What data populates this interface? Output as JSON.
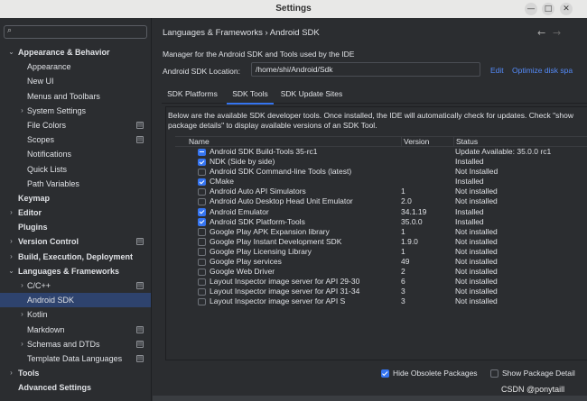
{
  "window": {
    "title": "Settings"
  },
  "search": {
    "placeholder": ""
  },
  "sidebar": {
    "items": [
      {
        "label": "Appearance & Behavior",
        "level": 0,
        "arrow": "expanded",
        "bold": true,
        "settings_icon": false,
        "selected": false
      },
      {
        "label": "Appearance",
        "level": 1,
        "arrow": "none",
        "bold": false,
        "settings_icon": false,
        "selected": false
      },
      {
        "label": "New UI",
        "level": 1,
        "arrow": "none",
        "bold": false,
        "settings_icon": false,
        "selected": false
      },
      {
        "label": "Menus and Toolbars",
        "level": 1,
        "arrow": "none",
        "bold": false,
        "settings_icon": false,
        "selected": false
      },
      {
        "label": "System Settings",
        "level": 1,
        "arrow": "collapsed",
        "bold": false,
        "settings_icon": false,
        "selected": false
      },
      {
        "label": "File Colors",
        "level": 1,
        "arrow": "none",
        "bold": false,
        "settings_icon": true,
        "selected": false
      },
      {
        "label": "Scopes",
        "level": 1,
        "arrow": "none",
        "bold": false,
        "settings_icon": true,
        "selected": false
      },
      {
        "label": "Notifications",
        "level": 1,
        "arrow": "none",
        "bold": false,
        "settings_icon": false,
        "selected": false
      },
      {
        "label": "Quick Lists",
        "level": 1,
        "arrow": "none",
        "bold": false,
        "settings_icon": false,
        "selected": false
      },
      {
        "label": "Path Variables",
        "level": 1,
        "arrow": "none",
        "bold": false,
        "settings_icon": false,
        "selected": false
      },
      {
        "label": "Keymap",
        "level": 0,
        "arrow": "none",
        "bold": true,
        "settings_icon": false,
        "selected": false
      },
      {
        "label": "Editor",
        "level": 0,
        "arrow": "collapsed",
        "bold": true,
        "settings_icon": false,
        "selected": false
      },
      {
        "label": "Plugins",
        "level": 0,
        "arrow": "none",
        "bold": true,
        "settings_icon": false,
        "selected": false
      },
      {
        "label": "Version Control",
        "level": 0,
        "arrow": "collapsed",
        "bold": true,
        "settings_icon": true,
        "selected": false
      },
      {
        "label": "Build, Execution, Deployment",
        "level": 0,
        "arrow": "collapsed",
        "bold": true,
        "settings_icon": false,
        "selected": false
      },
      {
        "label": "Languages & Frameworks",
        "level": 0,
        "arrow": "expanded",
        "bold": true,
        "settings_icon": false,
        "selected": false
      },
      {
        "label": "C/C++",
        "level": 1,
        "arrow": "collapsed",
        "bold": false,
        "settings_icon": true,
        "selected": false
      },
      {
        "label": "Android SDK",
        "level": 1,
        "arrow": "none",
        "bold": false,
        "settings_icon": false,
        "selected": true
      },
      {
        "label": "Kotlin",
        "level": 1,
        "arrow": "collapsed",
        "bold": false,
        "settings_icon": false,
        "selected": false
      },
      {
        "label": "Markdown",
        "level": 1,
        "arrow": "none",
        "bold": false,
        "settings_icon": true,
        "selected": false
      },
      {
        "label": "Schemas and DTDs",
        "level": 1,
        "arrow": "collapsed",
        "bold": false,
        "settings_icon": true,
        "selected": false
      },
      {
        "label": "Template Data Languages",
        "level": 1,
        "arrow": "none",
        "bold": false,
        "settings_icon": true,
        "selected": false
      },
      {
        "label": "Tools",
        "level": 0,
        "arrow": "collapsed",
        "bold": true,
        "settings_icon": false,
        "selected": false
      },
      {
        "label": "Advanced Settings",
        "level": 0,
        "arrow": "none",
        "bold": true,
        "settings_icon": false,
        "selected": false
      }
    ]
  },
  "main": {
    "breadcrumb": "Languages & Frameworks  ›  Android SDK",
    "description": "Manager for the Android SDK and Tools used by the IDE",
    "location_label": "Android SDK Location:",
    "location_value": "/home/shi/Android/Sdk",
    "edit_link": "Edit",
    "optimize_link": "Optimize disk spa",
    "tabs": [
      {
        "label": "SDK Platforms",
        "active": false
      },
      {
        "label": "SDK Tools",
        "active": true
      },
      {
        "label": "SDK Update Sites",
        "active": false
      }
    ],
    "notice": "Below are the available SDK developer tools. Once installed, the IDE will automatically check for updates. Check \"show package details\" to display available versions of an SDK Tool.",
    "columns": {
      "name": "Name",
      "version": "Version",
      "status": "Status"
    },
    "rows": [
      {
        "name": "Android SDK Build-Tools 35-rc1",
        "version": "",
        "status": "Update Available: 35.0.0 rc1",
        "check": "partial"
      },
      {
        "name": "NDK (Side by side)",
        "version": "",
        "status": "Installed",
        "check": "checked"
      },
      {
        "name": "Android SDK Command-line Tools (latest)",
        "version": "",
        "status": "Not Installed",
        "check": "unchecked"
      },
      {
        "name": "CMake",
        "version": "",
        "status": "Installed",
        "check": "checked"
      },
      {
        "name": "Android Auto API Simulators",
        "version": "1",
        "status": "Not installed",
        "check": "unchecked"
      },
      {
        "name": "Android Auto Desktop Head Unit Emulator",
        "version": "2.0",
        "status": "Not installed",
        "check": "unchecked"
      },
      {
        "name": "Android Emulator",
        "version": "34.1.19",
        "status": "Installed",
        "check": "checked"
      },
      {
        "name": "Android SDK Platform-Tools",
        "version": "35.0.0",
        "status": "Installed",
        "check": "checked"
      },
      {
        "name": "Google Play APK Expansion library",
        "version": "1",
        "status": "Not installed",
        "check": "unchecked"
      },
      {
        "name": "Google Play Instant Development SDK",
        "version": "1.9.0",
        "status": "Not installed",
        "check": "unchecked"
      },
      {
        "name": "Google Play Licensing Library",
        "version": "1",
        "status": "Not installed",
        "check": "unchecked"
      },
      {
        "name": "Google Play services",
        "version": "49",
        "status": "Not installed",
        "check": "unchecked"
      },
      {
        "name": "Google Web Driver",
        "version": "2",
        "status": "Not installed",
        "check": "unchecked"
      },
      {
        "name": "Layout Inspector image server for API 29-30",
        "version": "6",
        "status": "Not installed",
        "check": "unchecked"
      },
      {
        "name": "Layout Inspector image server for API 31-34",
        "version": "3",
        "status": "Not installed",
        "check": "unchecked"
      },
      {
        "name": "Layout Inspector image server for API S",
        "version": "3",
        "status": "Not installed",
        "check": "unchecked"
      }
    ],
    "hide_obsolete_label": "Hide Obsolete Packages",
    "hide_obsolete_checked": true,
    "show_details_label": "Show Package Detail",
    "show_details_checked": false
  },
  "watermark": "CSDN @ponytaill",
  "colors": {
    "accent": "#3574f0",
    "link": "#548af7",
    "selection": "#2e436e",
    "background": "#2b2d30"
  }
}
